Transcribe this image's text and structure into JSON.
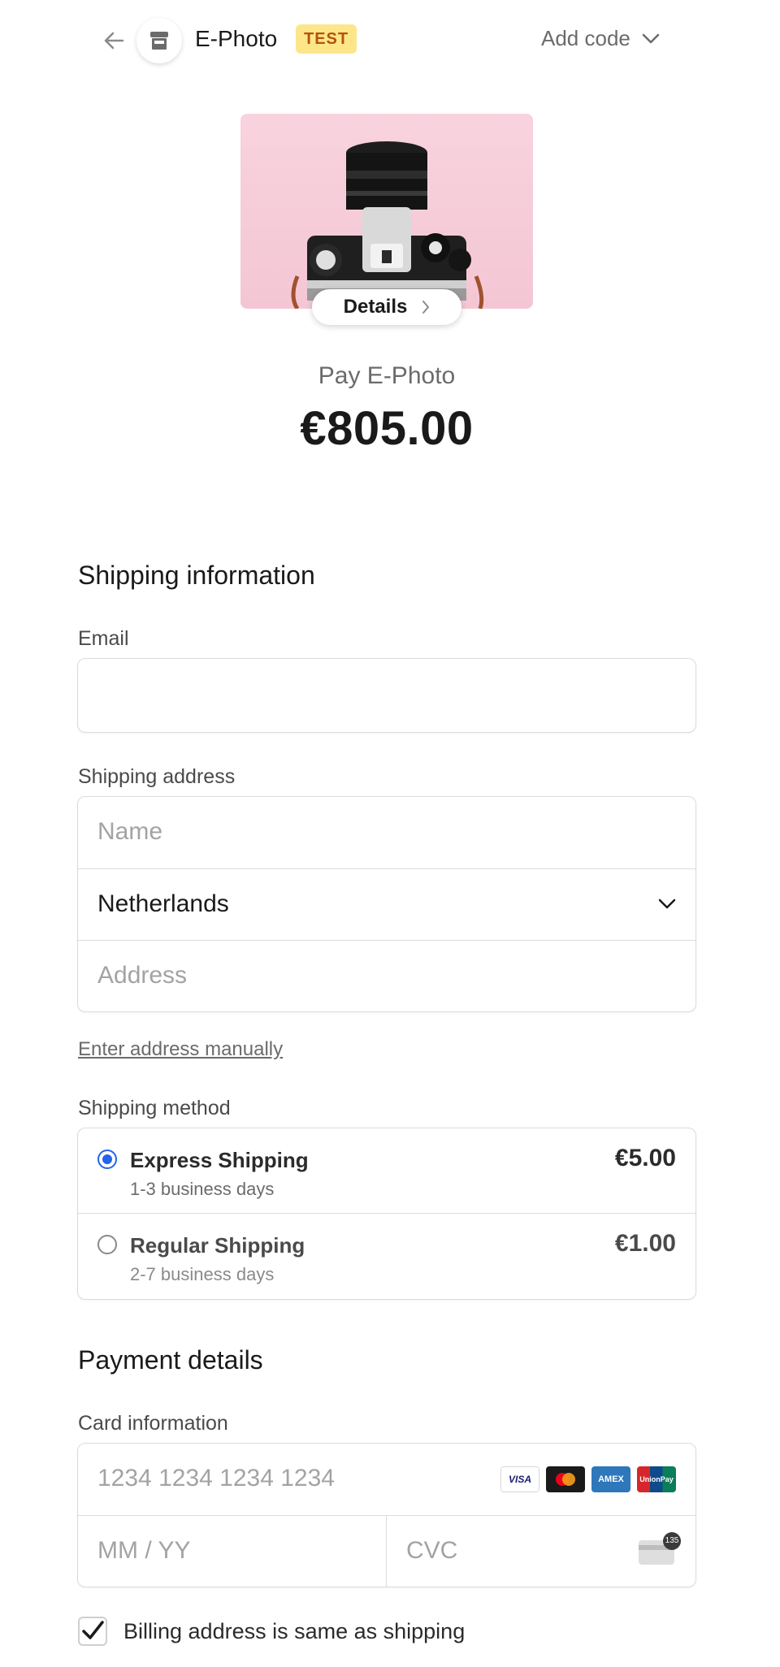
{
  "header": {
    "merchant_name": "E-Photo",
    "test_badge": "TEST",
    "add_code_label": "Add code"
  },
  "product": {
    "details_label": "Details",
    "pay_label": "Pay E-Photo",
    "amount": "€805.00"
  },
  "shipping": {
    "section_title": "Shipping information",
    "email_label": "Email",
    "email_value": "",
    "address_label": "Shipping address",
    "name_placeholder": "Name",
    "country_value": "Netherlands",
    "address_placeholder": "Address",
    "manual_link": "Enter address manually",
    "method_label": "Shipping method",
    "methods": [
      {
        "name": "Express Shipping",
        "sub": "1-3 business days",
        "price": "€5.00",
        "selected": true
      },
      {
        "name": "Regular Shipping",
        "sub": "2-7 business days",
        "price": "€1.00",
        "selected": false
      }
    ]
  },
  "payment": {
    "section_title": "Payment details",
    "card_label": "Card information",
    "card_number_placeholder": "1234 1234 1234 1234",
    "expiry_placeholder": "MM / YY",
    "cvc_placeholder": "CVC",
    "card_brands": [
      "VISA",
      "Mastercard",
      "AMEX",
      "UnionPay"
    ],
    "cvc_hint": "135"
  },
  "billing": {
    "same_as_shipping_label": "Billing address is same as shipping",
    "checked": true
  },
  "colors": {
    "accent": "#2563eb",
    "test_badge_bg": "#fde68a",
    "test_badge_fg": "#b45309",
    "product_bg": "#f8d3de"
  }
}
